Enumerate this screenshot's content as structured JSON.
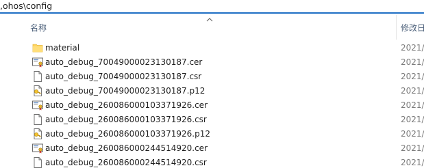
{
  "address": {
    "path": ",ohos\\config"
  },
  "header": {
    "name_column": "名称",
    "date_column": "修改日"
  },
  "files": [
    {
      "name": "material",
      "type": "folder",
      "date": "2021/"
    },
    {
      "name": "auto_debug_70049000023130187.cer",
      "type": "certificate-file",
      "date": "2021/"
    },
    {
      "name": "auto_debug_70049000023130187.csr",
      "type": "blank-file",
      "date": "2021/"
    },
    {
      "name": "auto_debug_70049000023130187.p12",
      "type": "keystore-file",
      "date": "2021/"
    },
    {
      "name": "auto_debug_260086000103371926.cer",
      "type": "certificate-file",
      "date": "2021/"
    },
    {
      "name": "auto_debug_260086000103371926.csr",
      "type": "blank-file",
      "date": "2021/"
    },
    {
      "name": "auto_debug_260086000103371926.p12",
      "type": "keystore-file",
      "date": "2021/"
    },
    {
      "name": "auto_debug_260086000244514920.cer",
      "type": "certificate-file",
      "date": "2021/"
    },
    {
      "name": "auto_debug_260086000244514920.csr",
      "type": "blank-file",
      "date": "2021/"
    }
  ],
  "colors": {
    "address_border": "#1f6fc4",
    "header_text": "#4c607a",
    "folder": "#ffd35c",
    "date_text": "#7a7a7a"
  }
}
